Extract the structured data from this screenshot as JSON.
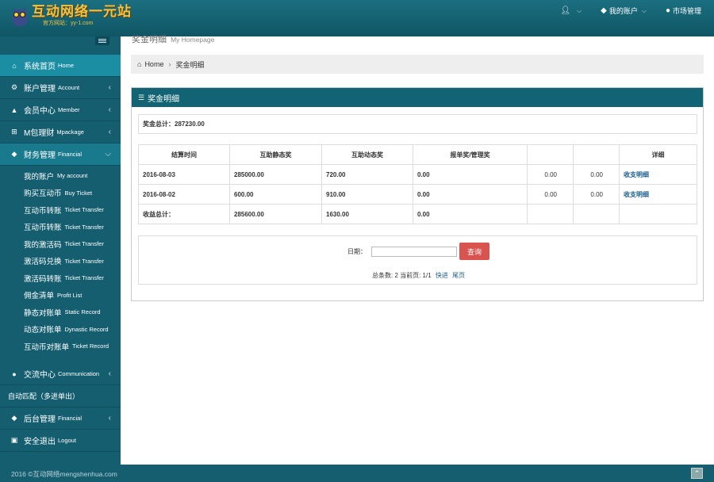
{
  "brand": {
    "title": "互动网络一元站",
    "subtitle": "官方网站：yy-1.com"
  },
  "topnav": [
    {
      "icon": "user-icon",
      "label": ""
    },
    {
      "icon": "tag-icon",
      "label": "我的账户"
    },
    {
      "icon": "globe-icon",
      "label": "市场管理"
    }
  ],
  "sidebar": {
    "items": [
      {
        "icon": "home-icon",
        "cn": "系统首页",
        "en": "Home"
      },
      {
        "icon": "gear-icon",
        "cn": "账户管理",
        "en": "Account"
      },
      {
        "icon": "user-icon",
        "cn": "会员中心",
        "en": "Member"
      },
      {
        "icon": "cart-icon",
        "cn": "M包理财",
        "en": "Mpackage"
      },
      {
        "icon": "tags-icon",
        "cn": "财务管理",
        "en": "Financial"
      },
      {
        "icon": "comments-icon",
        "cn": "交流中心",
        "en": "Communication"
      },
      {
        "icon": "",
        "cn": "自动匹配（多进单出）",
        "en": ""
      },
      {
        "icon": "tags-icon",
        "cn": "后台管理",
        "en": "Financial"
      },
      {
        "icon": "lock-icon",
        "cn": "安全退出",
        "en": "Logout"
      }
    ],
    "subitems": [
      {
        "cn": "我的账户",
        "en": "My account"
      },
      {
        "cn": "购买互动币",
        "en": "Buy Ticket"
      },
      {
        "cn": "互动币转账",
        "en": "Ticket Transfer"
      },
      {
        "cn": "互动币转账",
        "en": "Ticket Transfer"
      },
      {
        "cn": "我的激活码",
        "en": "Ticket Transfer"
      },
      {
        "cn": "激活码兑换",
        "en": "Ticket Transfer"
      },
      {
        "cn": "激活码转账",
        "en": "Ticket Transfer"
      },
      {
        "cn": "佣金清单",
        "en": "Profit List"
      },
      {
        "cn": "静态对账单",
        "en": "Static Record"
      },
      {
        "cn": "动态对账单",
        "en": "Dynastic Record"
      },
      {
        "cn": "互动币对账单",
        "en": "Ticket Record"
      }
    ]
  },
  "page": {
    "title": "奖金明细",
    "title_en": "My Homepage",
    "breadcrumb_home": "Home",
    "breadcrumb_current": "奖金明细",
    "panel_title": "奖金明细",
    "total_label": "奖金总计：287230.00"
  },
  "table": {
    "headers": [
      "结算时间",
      "互助静态奖",
      "互助动态奖",
      "报单奖/管理奖",
      "",
      "",
      "详细"
    ],
    "rows": [
      [
        "2016-08-03",
        "285000.00",
        "720.00",
        "0.00",
        "0.00",
        "0.00",
        "收支明细"
      ],
      [
        "2016-08-02",
        "600.00",
        "910.00",
        "0.00",
        "0.00",
        "0.00",
        "收支明细"
      ],
      [
        "收益总计：",
        "285600.00",
        "1630.00",
        "0.00",
        "",
        "",
        ""
      ]
    ]
  },
  "search": {
    "date_label": "日期：",
    "date_value": "",
    "query_label": "查询"
  },
  "pager": {
    "summary": "总条数: 2 当前页: 1/1",
    "jump": "快进",
    "prev": "尾页"
  },
  "footer": {
    "copyright": "2016 ©互动网络mengshenhua.com"
  }
}
